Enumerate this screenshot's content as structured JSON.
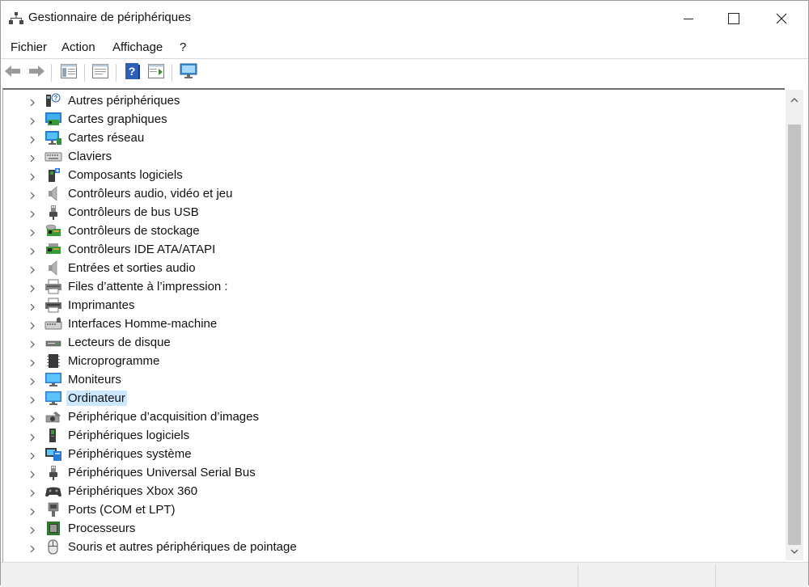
{
  "window": {
    "title": "Gestionnaire de périphériques"
  },
  "menu": [
    "Fichier",
    "Action",
    "Affichage",
    "?"
  ],
  "toolbar": [
    {
      "name": "back-arrow-icon"
    },
    {
      "name": "forward-arrow-icon"
    },
    {
      "name": "show-hide-console-tree-icon"
    },
    {
      "name": "properties-icon"
    },
    {
      "name": "help-icon"
    },
    {
      "name": "show-action-pane-icon"
    },
    {
      "name": "scan-hardware-icon"
    }
  ],
  "tree": {
    "items": [
      {
        "label": "Autres périphériques",
        "icon": "unknown-device-icon"
      },
      {
        "label": "Cartes graphiques",
        "icon": "display-adapter-icon"
      },
      {
        "label": "Cartes réseau",
        "icon": "network-adapter-icon"
      },
      {
        "label": "Claviers",
        "icon": "keyboard-icon"
      },
      {
        "label": "Composants logiciels",
        "icon": "software-component-icon"
      },
      {
        "label": "Contrôleurs audio, vidéo et jeu",
        "icon": "speaker-icon"
      },
      {
        "label": "Contrôleurs de bus USB",
        "icon": "usb-icon"
      },
      {
        "label": "Contrôleurs de stockage",
        "icon": "storage-controller-icon"
      },
      {
        "label": "Contrôleurs IDE ATA/ATAPI",
        "icon": "ide-controller-icon"
      },
      {
        "label": "Entrées et sorties audio",
        "icon": "speaker-icon"
      },
      {
        "label": "Files d’attente à l’impression :",
        "icon": "print-queue-icon"
      },
      {
        "label": "Imprimantes",
        "icon": "printer-icon"
      },
      {
        "label": "Interfaces Homme-machine",
        "icon": "hid-icon"
      },
      {
        "label": "Lecteurs de disque",
        "icon": "disk-drive-icon"
      },
      {
        "label": "Microprogramme",
        "icon": "firmware-icon"
      },
      {
        "label": "Moniteurs",
        "icon": "monitor-icon"
      },
      {
        "label": "Ordinateur",
        "icon": "computer-icon",
        "selected": true
      },
      {
        "label": "Périphérique d’acquisition d’images",
        "icon": "camera-icon"
      },
      {
        "label": "Périphériques logiciels",
        "icon": "software-device-icon"
      },
      {
        "label": "Périphériques système",
        "icon": "system-device-icon"
      },
      {
        "label": "Périphériques Universal Serial Bus",
        "icon": "usb-icon"
      },
      {
        "label": "Périphériques Xbox 360",
        "icon": "gamepad-icon"
      },
      {
        "label": "Ports (COM et LPT)",
        "icon": "port-icon"
      },
      {
        "label": "Processeurs",
        "icon": "processor-icon"
      },
      {
        "label": "Souris et autres périphériques de pointage",
        "icon": "mouse-icon"
      }
    ]
  },
  "colors": {
    "selection": "#cce8ff",
    "accent": "#0078d7"
  }
}
